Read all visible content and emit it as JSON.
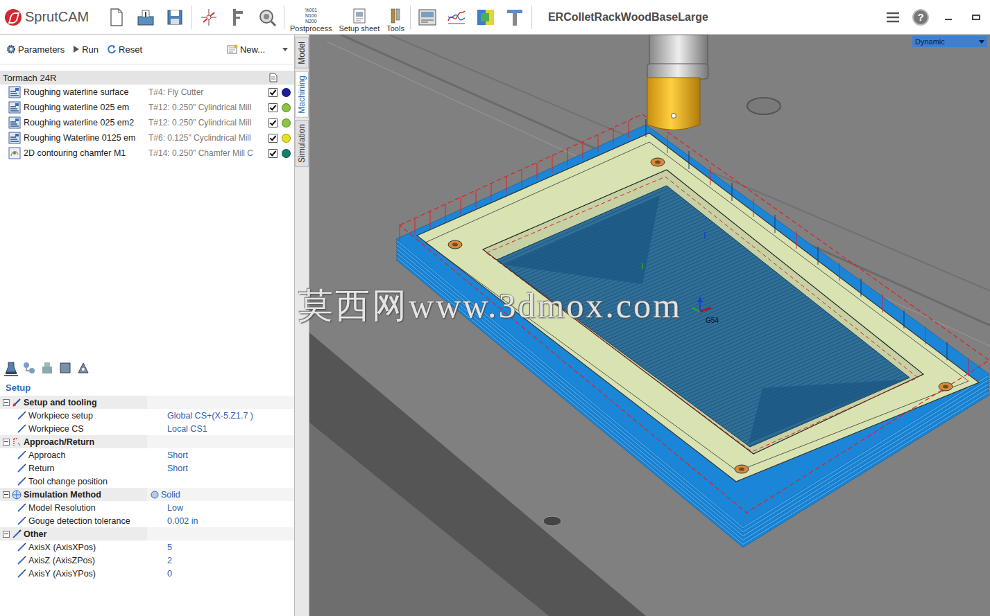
{
  "app": {
    "logo": "SprutCAM",
    "title": "ERColletRackWoodBaseLarge",
    "help": "?"
  },
  "toolbar_labeled": [
    {
      "label": "Postprocess",
      "icon_lines": [
        "%001",
        "N100",
        "N200"
      ]
    },
    {
      "label": "Setup sheet",
      "icon_lines": []
    },
    {
      "label": "Tools",
      "icon_lines": []
    }
  ],
  "op_bar": {
    "parameters": "Parameters",
    "run": "Run",
    "reset": "Reset",
    "new": "New..."
  },
  "machine": {
    "name": "Tormach 24R"
  },
  "operations": [
    {
      "name": "Roughing waterline surface",
      "tool": "T#4: Fly Cutter",
      "checked": true,
      "color": "#1b1f9e",
      "kind": "waterline"
    },
    {
      "name": "Roughing waterline 025 em",
      "tool": "T#12: 0.250\" Cylindrical Mill",
      "checked": true,
      "color": "#8cc63f",
      "kind": "waterline"
    },
    {
      "name": "Roughing waterline 025 em2",
      "tool": "T#12: 0.250\" Cylindrical Mill",
      "checked": true,
      "color": "#8cc63f",
      "kind": "waterline"
    },
    {
      "name": "Roughing Waterline 0125 em",
      "tool": "T#6: 0.125\" Cyclindrical Mill",
      "checked": true,
      "color": "#e6e21e",
      "kind": "waterline"
    },
    {
      "name": "2D contouring chamfer M1",
      "tool": "T#14: 0.250\" Chamfer Mill C",
      "checked": true,
      "color": "#137f6f",
      "kind": "contouring"
    }
  ],
  "vertical_tabs": [
    {
      "label": "Model",
      "selected": false
    },
    {
      "label": "Machining",
      "selected": true
    },
    {
      "label": "Simulation",
      "selected": false
    }
  ],
  "properties": {
    "tabs": [
      {
        "selected": true
      },
      {
        "selected": false
      },
      {
        "selected": false
      },
      {
        "selected": false
      },
      {
        "selected": false
      }
    ],
    "title": "Setup",
    "groups": [
      {
        "label": "Setup and tooling",
        "value": "",
        "expanded": true,
        "rows": [
          {
            "label": "Workpiece setup",
            "value": "Global CS+(X-5.Z1.7 )"
          },
          {
            "label": "Workpiece CS",
            "value": "Local CS1"
          }
        ]
      },
      {
        "label": "Approach/Return",
        "value": "",
        "expanded": true,
        "rows": [
          {
            "label": "Approach",
            "value": "Short"
          },
          {
            "label": "Return",
            "value": "Short"
          },
          {
            "label": "Tool change position",
            "value": ""
          }
        ]
      },
      {
        "label": "Simulation Method",
        "value": "Solid",
        "expanded": true,
        "rows": [
          {
            "label": "Model Resolution",
            "value": "Low"
          },
          {
            "label": "Gouge detection tolerance",
            "value": "0.002 in"
          }
        ]
      },
      {
        "label": "Other",
        "value": "",
        "expanded": true,
        "rows": [
          {
            "label": "AxisX (AxisXPos)",
            "value": "5"
          },
          {
            "label": "AxisZ (AxisZPos)",
            "value": "2"
          },
          {
            "label": "AxisY (AxisYPos)",
            "value": "0"
          }
        ]
      }
    ]
  },
  "viewport": {
    "view_mode": "Dynamic",
    "cs_label": "G54",
    "watermark": "莫西网www.3dmox.com"
  }
}
